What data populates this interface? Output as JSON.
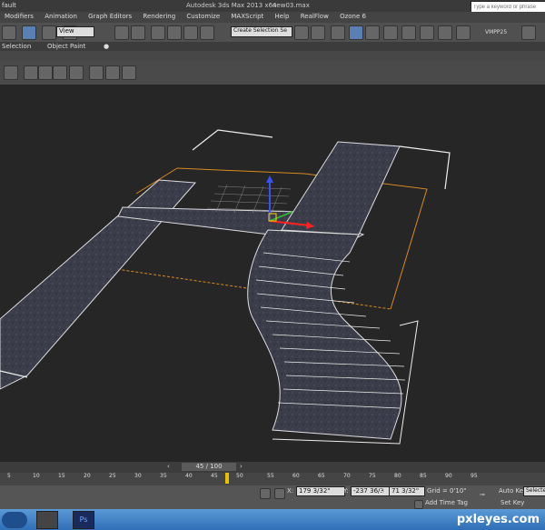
{
  "titlebar": {
    "workspace": "fault",
    "app_title": "Autodesk 3ds Max 2013 x64",
    "file_name": "new03.max",
    "search_placeholder": "Type a keyword or phrase"
  },
  "menu": [
    "Modifiers",
    "Animation",
    "Graph Editors",
    "Rendering",
    "Customize",
    "MAXScript",
    "Help",
    "RealFlow",
    "Ozone 6"
  ],
  "toolbar": {
    "view_dropdown": "View",
    "selection_set": "Create Selection Se",
    "plugin_label": "VMPP25"
  },
  "ribbon": {
    "tab_selection": "Selection",
    "tab_object_paint": "Object Paint"
  },
  "timeline": {
    "counter": "45 / 100",
    "ticks": [
      "5",
      "10",
      "15",
      "20",
      "25",
      "30",
      "35",
      "40",
      "45",
      "50",
      "55",
      "60",
      "65",
      "70",
      "75",
      "80",
      "85",
      "90",
      "95"
    ],
    "current_frame": 45
  },
  "status": {
    "x_label": "X:",
    "x_value": "179 3/32\"",
    "y_label": "Y:",
    "y_value": "-237 36/3",
    "z_label": "Z:",
    "z_value": "71 3/32\"",
    "grid": "Grid = 0'10\"",
    "add_time_tag": "Add Time Tag",
    "auto_key": "Auto Key",
    "set_key": "Set Key",
    "selected": "Selected"
  },
  "watermark": "pxleyes.com",
  "colors": {
    "accent": "#f0a030",
    "viewport": "#262626",
    "taskbar": "#3f80c8"
  }
}
